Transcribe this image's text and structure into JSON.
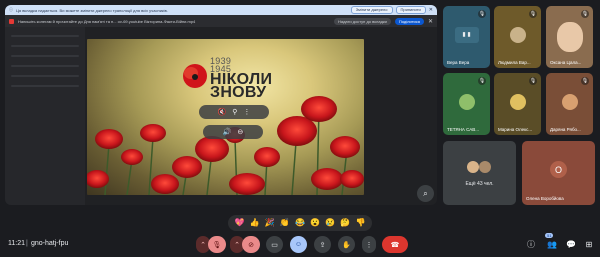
{
  "notice": {
    "text": "Ця вкладка надається. Ви можете змінити джерело трансляції для всіх учасників.",
    "share_button": "Змінити джерело",
    "stop_button": "Припинити",
    "dismiss_label": "Закрити"
  },
  "tab": {
    "title": "Напишіть колегам й прочитайте до Дня пам'яті та п... ov-69.youtube Вікторина-Факти-Війни.mp4",
    "share_pill": "Надати доступ до вкладки",
    "present_button": "Поділитися",
    "close_icon": "close-icon"
  },
  "slide": {
    "years": "1939\n1945",
    "slogan_line1": "НІКОЛИ",
    "slogan_line2": "ЗНОВУ"
  },
  "participants": [
    {
      "name": "Вера Вера",
      "avatar_initials": "",
      "bg": "#2e5a6e"
    },
    {
      "name": "Людмила Вар...",
      "avatar_initials": "",
      "bg": "#6e5a2a"
    },
    {
      "name": "Оксана Цала...",
      "avatar_initials": "",
      "bg": "#8a6c4f"
    },
    {
      "name": "ТЕТЯНА САВ...",
      "avatar_initials": "",
      "bg": "#2f6a3c"
    },
    {
      "name": "Марина Олекс...",
      "avatar_initials": "",
      "bg": "#5a4d27"
    },
    {
      "name": "Даряна Рябо...",
      "avatar_initials": "",
      "bg": "#7a4e37"
    }
  ],
  "others_tile": {
    "label": "Ещё 43 чел."
  },
  "olena_tile": {
    "avatar": "О",
    "name": "Олена Воробйова"
  },
  "reactions": [
    "💖",
    "👍",
    "🎉",
    "👏",
    "😂",
    "😮",
    "😢",
    "🤔",
    "👎"
  ],
  "bottom": {
    "time": "11:21",
    "separator": "|",
    "meeting_code": "gno-hatj-fpu",
    "participant_count": "51"
  },
  "colors": {
    "accent": "#a8c7fa",
    "hangup": "#dc362e",
    "mic_off": "#ea8a8a"
  }
}
